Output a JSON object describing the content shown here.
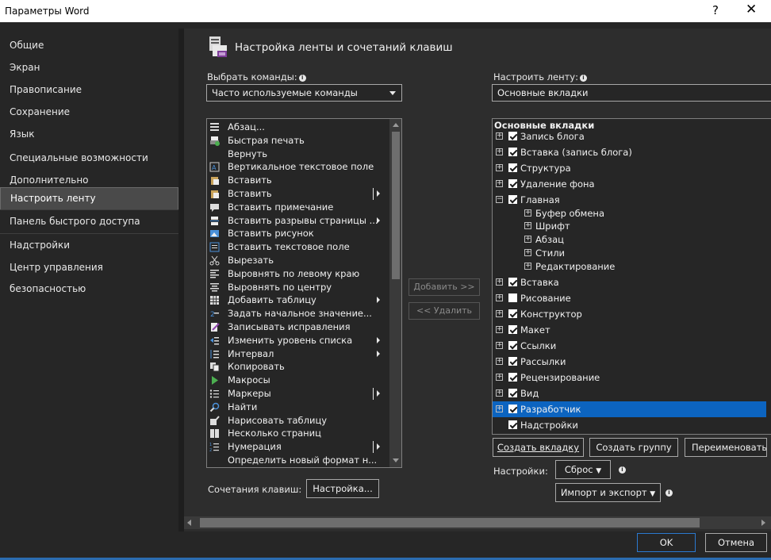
{
  "window": {
    "title": "Параметры Word",
    "help": "?",
    "close": "✕"
  },
  "nav": [
    {
      "label": "Общие"
    },
    {
      "label": "Экран"
    },
    {
      "label": "Правописание"
    },
    {
      "label": "Сохранение"
    },
    {
      "label": "Язык"
    },
    {
      "label": "Специальные возможности"
    },
    {
      "label": "Дополнительно"
    },
    {
      "label": "Настроить ленту",
      "selected": true
    },
    {
      "label": "Панель быстрого доступа"
    },
    {
      "label": "Надстройки"
    },
    {
      "label": "Центр управления безопасностью"
    }
  ],
  "header": {
    "title": "Настройка ленты и сочетаний клавиш"
  },
  "left": {
    "choose_label": "Выбрать команды:",
    "choose_value": "Часто используемые команды",
    "commands": [
      {
        "label": "Абзац...",
        "icon": "paragraph-icon"
      },
      {
        "label": "Быстрая печать",
        "icon": "quick-print-icon"
      },
      {
        "label": "Вернуть",
        "icon": "none"
      },
      {
        "label": "Вертикальное текстовое поле",
        "icon": "vertical-textbox-icon"
      },
      {
        "label": "Вставить",
        "icon": "paste-icon"
      },
      {
        "label": "Вставить",
        "icon": "paste-icon",
        "submenu": "split"
      },
      {
        "label": "Вставить примечание",
        "icon": "comment-icon"
      },
      {
        "label": "Вставить разрывы страницы ...",
        "icon": "page-break-icon",
        "submenu": "arrow"
      },
      {
        "label": "Вставить рисунок",
        "icon": "picture-icon"
      },
      {
        "label": "Вставить текстовое поле",
        "icon": "textbox-icon"
      },
      {
        "label": "Вырезать",
        "icon": "cut-icon"
      },
      {
        "label": "Выровнять по левому краю",
        "icon": "align-left-icon"
      },
      {
        "label": "Выровнять по центру",
        "icon": "align-center-icon"
      },
      {
        "label": "Добавить таблицу",
        "icon": "table-icon",
        "submenu": "arrow"
      },
      {
        "label": "Задать начальное значение...",
        "icon": "numbering-value-icon"
      },
      {
        "label": "Записывать исправления",
        "icon": "track-changes-icon"
      },
      {
        "label": "Изменить уровень списка",
        "icon": "list-level-icon",
        "submenu": "arrow"
      },
      {
        "label": "Интервал",
        "icon": "spacing-icon",
        "submenu": "arrow"
      },
      {
        "label": "Копировать",
        "icon": "copy-icon"
      },
      {
        "label": "Макросы",
        "icon": "macro-icon"
      },
      {
        "label": "Маркеры",
        "icon": "bullets-icon",
        "submenu": "split"
      },
      {
        "label": "Найти",
        "icon": "find-icon"
      },
      {
        "label": "Нарисовать таблицу",
        "icon": "draw-table-icon"
      },
      {
        "label": "Несколько страниц",
        "icon": "multi-page-icon"
      },
      {
        "label": "Нумерация",
        "icon": "numbering-icon",
        "submenu": "split"
      },
      {
        "label": "Определить новый формат н...",
        "icon": "none"
      }
    ],
    "shortcuts_label": "Сочетания клавиш:",
    "shortcuts_button": "Настройка..."
  },
  "middle": {
    "add": "Добавить >>",
    "remove": "<< Удалить"
  },
  "right": {
    "customize_label": "Настроить ленту:",
    "customize_value": "Основные вкладки",
    "tree_header": "Основные вкладки",
    "tree": [
      {
        "label": "Запись блога",
        "level": 0,
        "exp": "+",
        "check": true
      },
      {
        "label": "Вставка (запись блога)",
        "level": 0,
        "exp": "+",
        "check": true
      },
      {
        "label": "Структура",
        "level": 0,
        "exp": "+",
        "check": true
      },
      {
        "label": "Удаление фона",
        "level": 0,
        "exp": "+",
        "check": true
      },
      {
        "label": "Главная",
        "level": 0,
        "exp": "−",
        "check": true
      },
      {
        "label": "Буфер обмена",
        "level": 1,
        "exp": "+"
      },
      {
        "label": "Шрифт",
        "level": 1,
        "exp": "+"
      },
      {
        "label": "Абзац",
        "level": 1,
        "exp": "+"
      },
      {
        "label": "Стили",
        "level": 1,
        "exp": "+"
      },
      {
        "label": "Редактирование",
        "level": 1,
        "exp": "+"
      },
      {
        "label": "Вставка",
        "level": 0,
        "exp": "+",
        "check": true
      },
      {
        "label": "Рисование",
        "level": 0,
        "exp": "+",
        "check": false
      },
      {
        "label": "Конструктор",
        "level": 0,
        "exp": "+",
        "check": true
      },
      {
        "label": "Макет",
        "level": 0,
        "exp": "+",
        "check": true
      },
      {
        "label": "Ссылки",
        "level": 0,
        "exp": "+",
        "check": true
      },
      {
        "label": "Рассылки",
        "level": 0,
        "exp": "+",
        "check": true
      },
      {
        "label": "Рецензирование",
        "level": 0,
        "exp": "+",
        "check": true
      },
      {
        "label": "Вид",
        "level": 0,
        "exp": "+",
        "check": true
      },
      {
        "label": "Разработчик",
        "level": 0,
        "exp": "+",
        "check": true,
        "highlight": true
      },
      {
        "label": "Надстройки",
        "level": 0,
        "exp": "",
        "check": true
      }
    ],
    "new_tab": "Создать вкладку",
    "new_group": "Создать группу",
    "rename": "Переименовать...",
    "settings_label": "Настройки:",
    "reset": "Сброс",
    "import_export": "Импорт и экспорт"
  },
  "footer": {
    "ok": "OK",
    "cancel": "Отмена"
  },
  "colors": {
    "accent": "#0c64c0",
    "background": "#262626",
    "panel": "#2d2d2d"
  }
}
